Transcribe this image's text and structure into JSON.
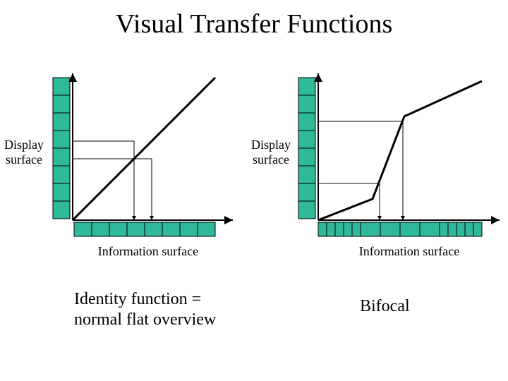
{
  "title": "Visual Transfer Functions",
  "left": {
    "ylabel_line1": "Display",
    "ylabel_line2": "surface",
    "xlabel": "Information surface",
    "caption_line1": "Identity function =",
    "caption_line2": "normal flat overview"
  },
  "right": {
    "ylabel_line1": "Display",
    "ylabel_line2": "surface",
    "xlabel": "Information surface",
    "caption": "Bifocal"
  },
  "colors": {
    "cell_fill": "#2fb89a",
    "stroke": "#000000"
  },
  "chart_data": [
    {
      "type": "line",
      "title": "Identity function = normal flat overview",
      "xlabel": "Information surface",
      "ylabel": "Display surface",
      "x": [
        0,
        1
      ],
      "y": [
        0,
        1
      ],
      "note": "Identity transfer function: display coordinate equals information coordinate (diagonal line). Vertical axis decorated with 8 green cells, horizontal axis decorated with 8 green cells, representing uniform mapping between information surface and display surface."
    },
    {
      "type": "line",
      "title": "Bifocal",
      "xlabel": "Information surface",
      "ylabel": "Display surface",
      "x": [
        0.0,
        0.35,
        0.55,
        1.0
      ],
      "y": [
        0.0,
        0.15,
        0.7,
        1.0
      ],
      "note": "Piecewise-linear bifocal transfer function: shallow slope (compressed periphery), steep slope (magnified focus region), shallow slope again. Vertical axis decorated with 8 green cells, horizontal axis decorated with 14 green cells of varying width reflecting the non-uniform mapping."
    }
  ]
}
